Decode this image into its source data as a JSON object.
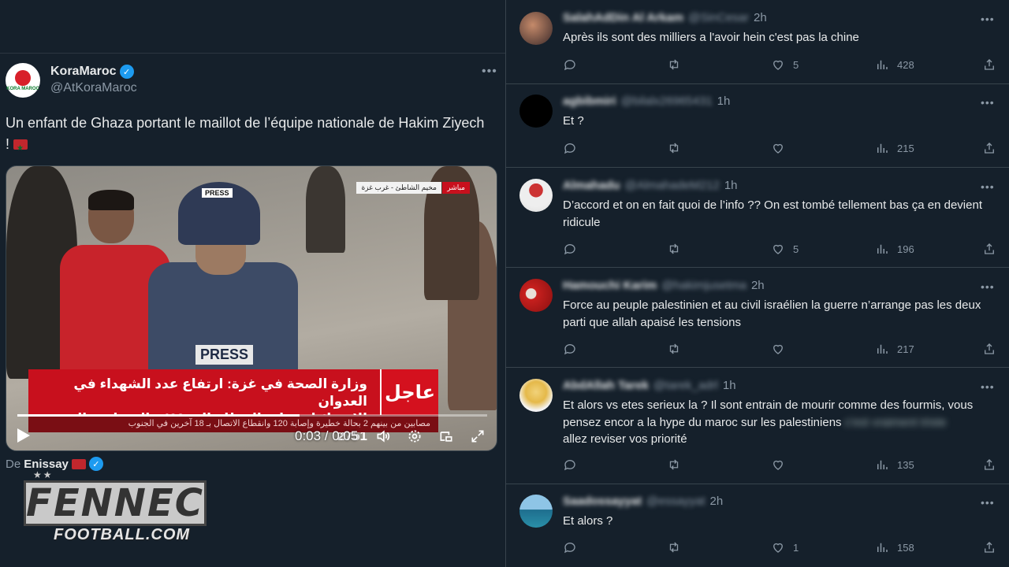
{
  "main_tweet": {
    "author_name": "KoraMaroc",
    "handle": "@AtKoraMaroc",
    "avatar_text": "KORA MAROC",
    "text": "Un enfant de Ghaza portant le maillot de l’équipe nationale de Hakim Ziyech !",
    "from_prefix": "De",
    "from_name": "Enissay"
  },
  "video": {
    "ticker_line1": "وزارة الصحة في غزة: ارتفاع عدد الشهداء في العدوان",
    "ticker_line2": "الإسرائيلي على القطاع إلى 493 والمصابين إلى 2751",
    "ticker_bottom": "مصابين من بينهم 2 بحالة خطيرة وإصابة 120 وانقطاع الاتصال بـ 18 آخرين في الجنوب",
    "breaking_label": "عاجل",
    "live_label": "مباشر",
    "place_label": "مخيم الشاطئ - غرب غزة",
    "helmet_label": "PRESS",
    "vest_label": "PRESS",
    "time_display": "0:03 / 0:05",
    "progress": 0.6
  },
  "watermark": {
    "stars": "★★",
    "title": "FENNEC",
    "subtitle": "FOOTBALL.COM"
  },
  "replies": [
    {
      "name": "SalahAdDin Al Arkam",
      "handle": "@SinCesar",
      "time": "2h",
      "text": "Après ils sont des milliers a l'avoir hein c'est pas la chine",
      "likes": "5",
      "views": "428"
    },
    {
      "name": "agbibmiri",
      "handle": "@bilalx26965431",
      "time": "1h",
      "text": "Et ?",
      "likes": "",
      "views": "215"
    },
    {
      "name": "Almahadu",
      "handle": "@AlmahadeM212",
      "time": "1h",
      "text": "D’accord et on en fait quoi de l’info ?? On est tombé tellement bas ça en devient ridicule",
      "likes": "5",
      "views": "196"
    },
    {
      "name": "Hamouchi Karim",
      "handle": "@hakimjusetma",
      "time": "2h",
      "text": "Force au peuple palestinien et au civil israélien la guerre n’arrange pas les deux parti que allah apaisé les tensions",
      "likes": "",
      "views": "217"
    },
    {
      "name": "AbdAllah Tarek",
      "handle": "@tarek_adrl",
      "time": "1h",
      "text": "Et alors vs etes serieux la ? Il sont entrain de mourir comme des fourmis, vous pensez encor a la hype du maroc sur les palestiniens",
      "text_blurred": "c'est vraiment triste",
      "text2": "allez reviser vos priorité",
      "likes": "",
      "views": "135"
    },
    {
      "name": "Saadossayyat",
      "handle": "@essayyat",
      "time": "2h",
      "text": "Et alors ?",
      "likes": "1",
      "views": "158"
    }
  ]
}
